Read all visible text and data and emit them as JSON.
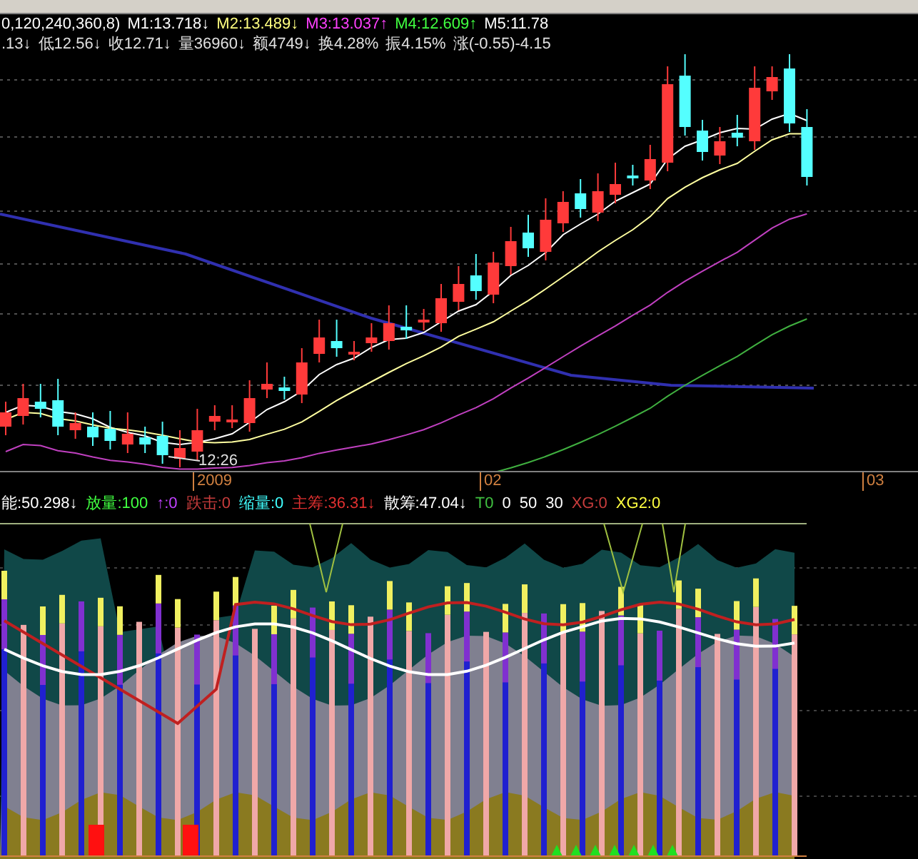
{
  "ma_legend": [
    {
      "text": "0,120,240,360,8)",
      "color": "#ffffff"
    },
    {
      "text": "M1:13.718↓",
      "color": "#ffffff"
    },
    {
      "text": "M2:13.489↓",
      "color": "#ffff80"
    },
    {
      "text": "M3:13.037↑",
      "color": "#ff40ff"
    },
    {
      "text": "M4:12.609↑",
      "color": "#40ff40"
    },
    {
      "text": "M5:11.78",
      "color": "#ffffff"
    }
  ],
  "quote_line": [
    ".13↓",
    "低12.56↓",
    "收12.71↓",
    "量36960↓",
    "额4749↓",
    "换4.28%",
    "振4.15%",
    "涨(-0.55)-4.15"
  ],
  "price_chart": {
    "low_label": "12:26"
  },
  "date_axis": [
    {
      "label": "2009"
    },
    {
      "label": "02"
    },
    {
      "label": "03"
    }
  ],
  "indicator_legend": [
    {
      "text": "能:50.298↓",
      "color": "#ffffff"
    },
    {
      "text": "放量:100",
      "color": "#40ff40"
    },
    {
      "text": "↑:0",
      "color": "#c040ff"
    },
    {
      "text": "跌击:0",
      "color": "#c83c3c"
    },
    {
      "text": "缩量:0",
      "color": "#40ffff"
    },
    {
      "text": "主筹:36.31↓",
      "color": "#e03030"
    },
    {
      "text": "散筹:47.04↓",
      "color": "#ffffff"
    },
    {
      "text": "T0",
      "color": "#40c040"
    },
    {
      "text": "0",
      "color": "#ffffff"
    },
    {
      "text": "50",
      "color": "#ffffff"
    },
    {
      "text": "30",
      "color": "#ffffff"
    },
    {
      "text": "XG:0",
      "color": "#c83c3c"
    },
    {
      "text": "XG2:0",
      "color": "#ffff40"
    }
  ]
}
